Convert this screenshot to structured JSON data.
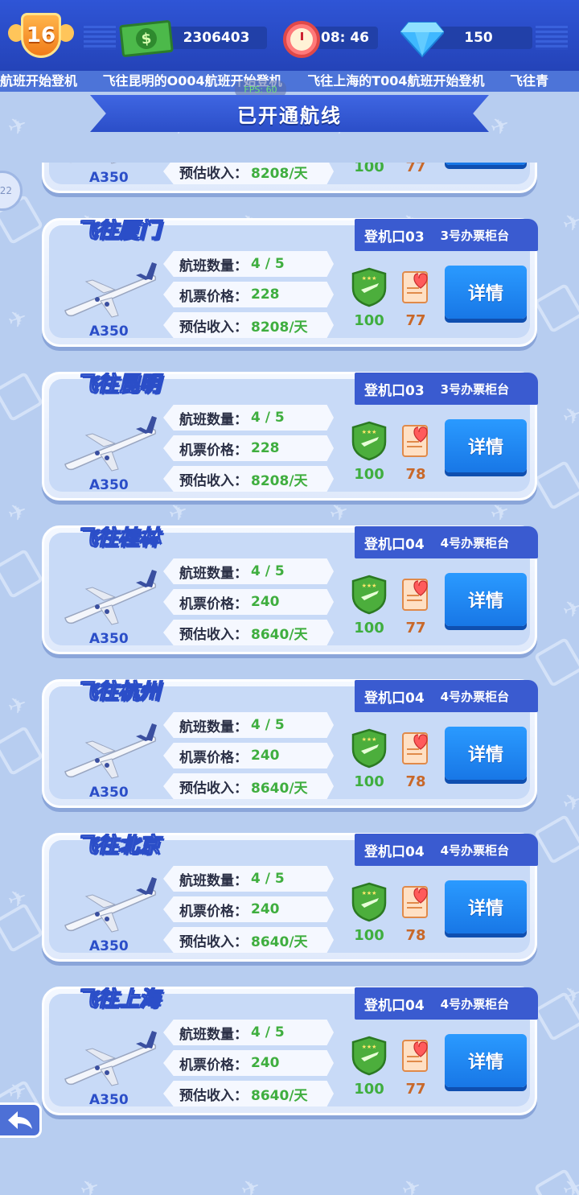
{
  "top_bar": {
    "level": "16",
    "cash": "2306403",
    "cash_symbol": "$",
    "timer": "08: 46",
    "gems": "150"
  },
  "ticker": {
    "messages": [
      "航班开始登机",
      "飞往昆明的O004航班开始登机",
      "飞往上海的T004航班开始登机",
      "飞往青"
    ]
  },
  "fps_label": "FPS: 60",
  "title": "已开通航线",
  "labels": {
    "flights": "航班数量：",
    "price": "机票价格：",
    "income": "预估收入：",
    "detail": "详情"
  },
  "side_badge": "22",
  "routes": [
    {
      "destination": "",
      "gate": "",
      "counter": "",
      "model": "A350",
      "flights": "",
      "price": "228",
      "income": "8208/天",
      "shield": "100",
      "heart": "77"
    },
    {
      "destination": "飞往厦门",
      "gate": "登机口03",
      "counter": "3号办票柜台",
      "model": "A350",
      "flights": "4 / 5",
      "price": "228",
      "income": "8208/天",
      "shield": "100",
      "heart": "77"
    },
    {
      "destination": "飞往昆明",
      "gate": "登机口03",
      "counter": "3号办票柜台",
      "model": "A350",
      "flights": "4 / 5",
      "price": "228",
      "income": "8208/天",
      "shield": "100",
      "heart": "78"
    },
    {
      "destination": "飞往桂林",
      "gate": "登机口04",
      "counter": "4号办票柜台",
      "model": "A350",
      "flights": "4 / 5",
      "price": "240",
      "income": "8640/天",
      "shield": "100",
      "heart": "77"
    },
    {
      "destination": "飞往杭州",
      "gate": "登机口04",
      "counter": "4号办票柜台",
      "model": "A350",
      "flights": "4 / 5",
      "price": "240",
      "income": "8640/天",
      "shield": "100",
      "heart": "78"
    },
    {
      "destination": "飞往北京",
      "gate": "登机口04",
      "counter": "4号办票柜台",
      "model": "A350",
      "flights": "4 / 5",
      "price": "240",
      "income": "8640/天",
      "shield": "100",
      "heart": "78"
    },
    {
      "destination": "飞往上海",
      "gate": "登机口04",
      "counter": "4号办票柜台",
      "model": "A350",
      "flights": "4 / 5",
      "price": "240",
      "income": "8640/天",
      "shield": "100",
      "heart": "77"
    }
  ],
  "icons": {
    "level": "level-shield-icon",
    "cash": "cash-icon",
    "timer": "alarm-clock-icon",
    "gems": "diamond-icon",
    "plane": "airplane-icon",
    "shield": "safety-shield-icon",
    "heart": "satisfaction-heart-icon",
    "back": "back-arrow-icon"
  },
  "colors": {
    "primary": "#2b4ec8",
    "button": "#1f88f2",
    "green_value": "#3fae3f",
    "orange_value": "#c8682a"
  }
}
